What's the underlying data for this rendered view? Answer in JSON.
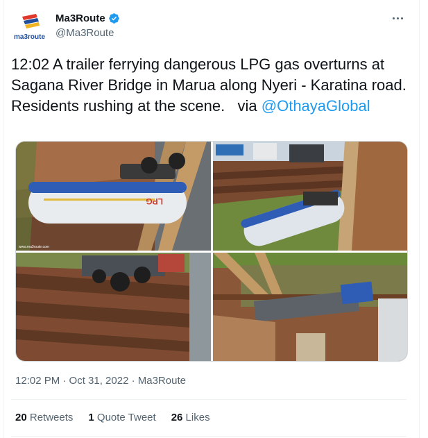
{
  "author": {
    "display_name": "Ma3Route",
    "handle": "@Ma3Route",
    "logo_text": "ma3route",
    "verified_icon": "verified-badge-icon"
  },
  "tweet": {
    "text": "12:02 A trailer ferrying dangerous LPG gas overturns at Sagana River Bridge in Marua along Nyeri - Karatina road. Residents rushing at the scene.   via ",
    "mention": "@OthayaGlobal"
  },
  "media": {
    "photos": [
      {
        "description_icon": "overturned-tanker-photo",
        "tank_label": "LPG",
        "watermark": "www.ma3route.com"
      },
      {
        "description_icon": "bridge-crash-scene-photo"
      },
      {
        "description_icon": "truck-cab-on-riverbank-photo"
      },
      {
        "description_icon": "tanker-in-river-photo"
      }
    ]
  },
  "meta": {
    "timestamp": "12:02 PM · Oct 31, 2022 · Ma3Route"
  },
  "stats": {
    "retweets_count": "20",
    "retweets_label": "Retweets",
    "quotes_count": "1",
    "quotes_label": "Quote Tweet",
    "likes_count": "26",
    "likes_label": "Likes"
  },
  "colors": {
    "accent": "#1d9bf0",
    "secondary_text": "#536471",
    "divider": "#eff3f4"
  }
}
